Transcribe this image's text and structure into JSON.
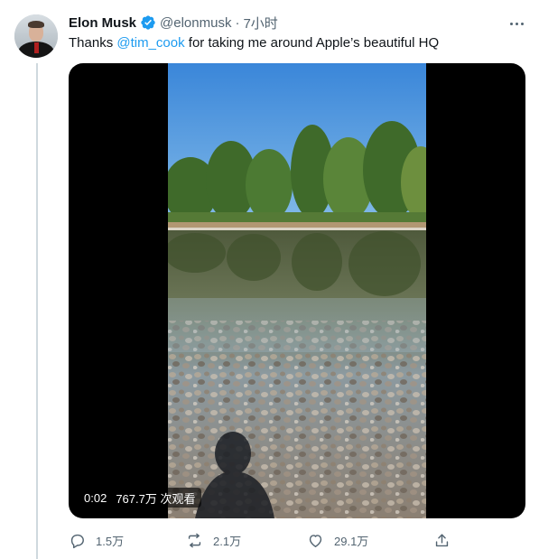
{
  "tweet": {
    "author_name": "Elon Musk",
    "handle": "@elonmusk",
    "separator": "·",
    "timestamp": "7小时",
    "text_before": "Thanks ",
    "mention": "@tim_cook",
    "text_after": " for taking me around Apple’s beautiful HQ"
  },
  "video": {
    "elapsed": "0:02",
    "views": "767.7万 次观看"
  },
  "actions": {
    "reply_count": "1.5万",
    "retweet_count": "2.1万",
    "like_count": "29.1万"
  },
  "icons": {
    "verified": "verified-badge-icon",
    "more": "more-icon",
    "reply": "reply-icon",
    "retweet": "retweet-icon",
    "like": "heart-icon",
    "share": "share-icon"
  },
  "colors": {
    "accent": "#1d9bf0",
    "text_primary": "#0f1419",
    "text_secondary": "#536471",
    "thread_line": "#cfd9de"
  }
}
